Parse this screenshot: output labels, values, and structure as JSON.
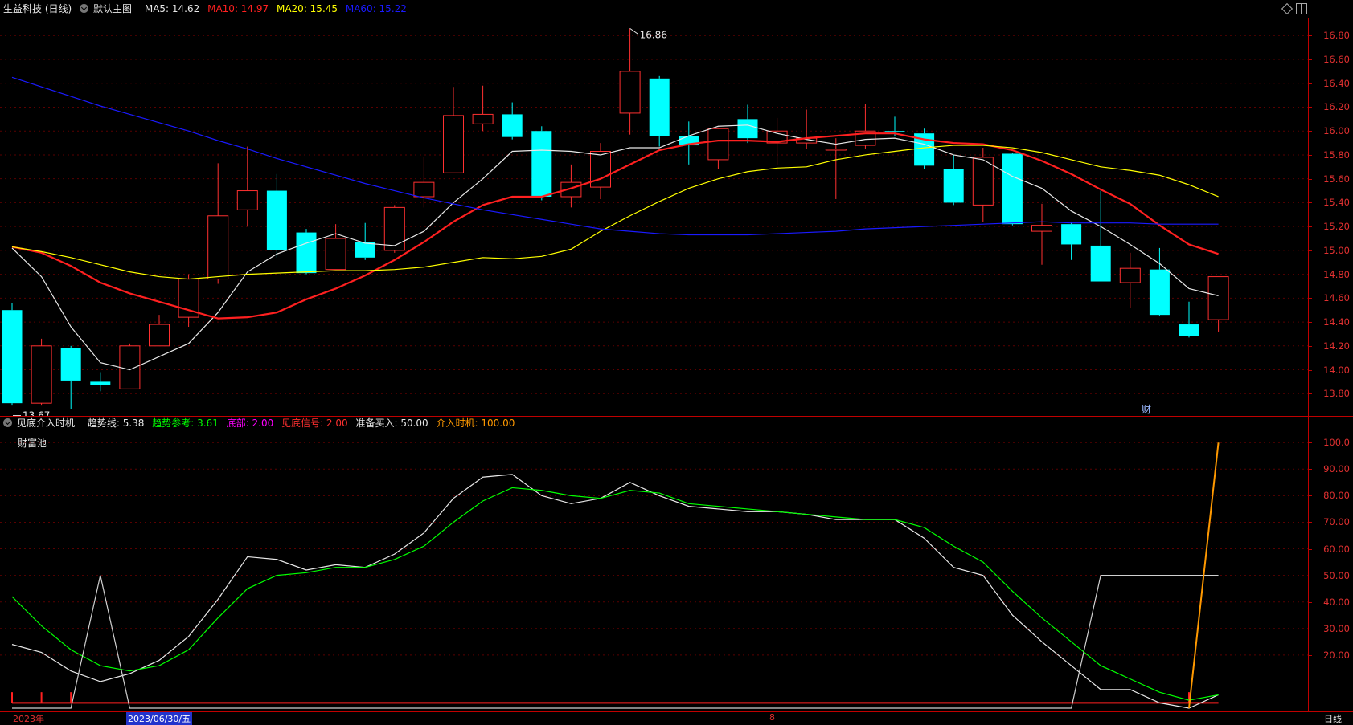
{
  "header": {
    "title": "生益科技 (日线)",
    "mode": "默认主图",
    "ma": [
      {
        "label": "MA5: 14.62",
        "color": "#e8e8e8"
      },
      {
        "label": "MA10: 14.97",
        "color": "#ff2020"
      },
      {
        "label": "MA20: 15.45",
        "color": "#ffff00"
      },
      {
        "label": "MA60: 15.22",
        "color": "#1a1aff"
      }
    ]
  },
  "indicator_header": {
    "name": "见底介入时机",
    "items": [
      {
        "label": "趋势线: 5.38",
        "color": "#e8e8e8"
      },
      {
        "label": "趋势参考: 3.61",
        "color": "#00ff00"
      },
      {
        "label": "底部: 2.00",
        "color": "#ff00ff"
      },
      {
        "label": "见底信号: 2.00",
        "color": "#ff3030"
      },
      {
        "label": "准备买入: 50.00",
        "color": "#e8e8e8"
      },
      {
        "label": "介入时机: 100.00",
        "color": "#ff9900"
      }
    ],
    "pool_label": "财富池"
  },
  "price_axis": [
    "16.80",
    "16.60",
    "16.40",
    "16.20",
    "16.00",
    "15.80",
    "15.60",
    "15.40",
    "15.20",
    "15.00",
    "14.80",
    "14.60",
    "14.40",
    "14.20",
    "14.00",
    "13.80"
  ],
  "ind_axis": [
    "100.0",
    "90.00",
    "80.00",
    "70.00",
    "60.00",
    "50.00",
    "40.00",
    "30.00",
    "20.00"
  ],
  "annotations": {
    "high": "16.86",
    "low": "13.67",
    "marker": "财"
  },
  "footer": {
    "year": "2023年",
    "date": "2023/06/30/五",
    "month": "8",
    "period": "日线"
  },
  "icons": [
    "diamond-icon",
    "panel-toggle-icon"
  ],
  "chart_data": [
    {
      "type": "candlestick",
      "title": "生益科技 (日线)",
      "ylim": [
        13.6,
        16.95
      ],
      "candles": [
        {
          "o": 14.5,
          "h": 14.56,
          "l": 13.7,
          "c": 13.72
        },
        {
          "o": 13.72,
          "h": 14.26,
          "l": 13.7,
          "c": 14.2
        },
        {
          "o": 14.18,
          "h": 14.2,
          "l": 13.67,
          "c": 13.91
        },
        {
          "o": 13.9,
          "h": 13.98,
          "l": 13.82,
          "c": 13.87
        },
        {
          "o": 13.84,
          "h": 14.22,
          "l": 13.84,
          "c": 14.2
        },
        {
          "o": 14.2,
          "h": 14.46,
          "l": 14.2,
          "c": 14.38
        },
        {
          "o": 14.44,
          "h": 14.8,
          "l": 14.36,
          "c": 14.76
        },
        {
          "o": 14.76,
          "h": 15.73,
          "l": 14.72,
          "c": 15.29
        },
        {
          "o": 15.34,
          "h": 15.87,
          "l": 15.2,
          "c": 15.5
        },
        {
          "o": 15.5,
          "h": 15.64,
          "l": 14.94,
          "c": 15.0
        },
        {
          "o": 15.15,
          "h": 15.18,
          "l": 14.8,
          "c": 14.81
        },
        {
          "o": 14.84,
          "h": 15.22,
          "l": 14.84,
          "c": 15.1
        },
        {
          "o": 15.07,
          "h": 15.23,
          "l": 14.92,
          "c": 14.94
        },
        {
          "o": 15.0,
          "h": 15.38,
          "l": 14.98,
          "c": 15.36
        },
        {
          "o": 15.45,
          "h": 15.78,
          "l": 15.36,
          "c": 15.57
        },
        {
          "o": 15.65,
          "h": 16.37,
          "l": 15.65,
          "c": 16.13
        },
        {
          "o": 16.06,
          "h": 16.38,
          "l": 16.0,
          "c": 16.14
        },
        {
          "o": 16.14,
          "h": 16.24,
          "l": 15.93,
          "c": 15.95
        },
        {
          "o": 16.0,
          "h": 16.04,
          "l": 15.42,
          "c": 15.45
        },
        {
          "o": 15.45,
          "h": 15.72,
          "l": 15.36,
          "c": 15.57
        },
        {
          "o": 15.53,
          "h": 15.9,
          "l": 15.43,
          "c": 15.83
        },
        {
          "o": 16.15,
          "h": 16.86,
          "l": 15.97,
          "c": 16.5
        },
        {
          "o": 16.44,
          "h": 16.46,
          "l": 15.87,
          "c": 15.96
        },
        {
          "o": 15.96,
          "h": 16.08,
          "l": 15.72,
          "c": 15.88
        },
        {
          "o": 15.76,
          "h": 16.03,
          "l": 15.68,
          "c": 16.02
        },
        {
          "o": 16.1,
          "h": 16.22,
          "l": 15.9,
          "c": 15.94
        },
        {
          "o": 15.9,
          "h": 16.11,
          "l": 15.72,
          "c": 16.0
        },
        {
          "o": 15.9,
          "h": 16.18,
          "l": 15.85,
          "c": 15.94
        },
        {
          "o": 15.85,
          "h": 15.94,
          "l": 15.43,
          "c": 15.85
        },
        {
          "o": 15.88,
          "h": 16.23,
          "l": 15.85,
          "c": 16.0
        },
        {
          "o": 16.0,
          "h": 16.12,
          "l": 15.96,
          "c": 15.99
        },
        {
          "o": 15.98,
          "h": 16.02,
          "l": 15.68,
          "c": 15.71
        },
        {
          "o": 15.68,
          "h": 15.8,
          "l": 15.38,
          "c": 15.4
        },
        {
          "o": 15.38,
          "h": 15.86,
          "l": 15.24,
          "c": 15.78
        },
        {
          "o": 15.81,
          "h": 15.82,
          "l": 15.21,
          "c": 15.22
        },
        {
          "o": 15.16,
          "h": 15.39,
          "l": 14.88,
          "c": 15.21
        },
        {
          "o": 15.22,
          "h": 15.24,
          "l": 14.92,
          "c": 15.05
        },
        {
          "o": 15.04,
          "h": 15.5,
          "l": 14.74,
          "c": 14.74
        },
        {
          "o": 14.73,
          "h": 14.98,
          "l": 14.52,
          "c": 14.85
        },
        {
          "o": 14.84,
          "h": 15.02,
          "l": 14.45,
          "c": 14.46
        },
        {
          "o": 14.38,
          "h": 14.57,
          "l": 14.27,
          "c": 14.28
        },
        {
          "o": 14.42,
          "h": 14.78,
          "l": 14.32,
          "c": 14.78
        }
      ],
      "series": [
        {
          "name": "MA5",
          "color": "#e8e8e8",
          "values": [
            15.02,
            14.78,
            14.36,
            14.06,
            14.0,
            14.11,
            14.22,
            14.48,
            14.82,
            14.97,
            15.06,
            15.14,
            15.06,
            15.04,
            15.16,
            15.4,
            15.6,
            15.83,
            15.84,
            15.83,
            15.8,
            15.86,
            15.86,
            15.96,
            16.04,
            16.05,
            15.98,
            15.93,
            15.89,
            15.93,
            15.94,
            15.89,
            15.8,
            15.76,
            15.62,
            15.52,
            15.33,
            15.2,
            15.05,
            14.89,
            14.68,
            14.62
          ]
        },
        {
          "name": "MA10",
          "color": "#ff2020",
          "values": [
            15.03,
            14.98,
            14.87,
            14.73,
            14.64,
            14.57,
            14.5,
            14.43,
            14.44,
            14.48,
            14.59,
            14.68,
            14.79,
            14.92,
            15.07,
            15.24,
            15.38,
            15.45,
            15.45,
            15.52,
            15.6,
            15.72,
            15.84,
            15.89,
            15.92,
            15.92,
            15.91,
            15.94,
            15.96,
            15.98,
            15.98,
            15.93,
            15.9,
            15.89,
            15.84,
            15.75,
            15.64,
            15.51,
            15.39,
            15.21,
            15.05,
            14.97
          ]
        },
        {
          "name": "MA20",
          "color": "#ffff00",
          "values": [
            15.03,
            14.99,
            14.94,
            14.88,
            14.82,
            14.78,
            14.76,
            14.78,
            14.8,
            14.81,
            14.82,
            14.83,
            14.83,
            14.84,
            14.86,
            14.9,
            14.94,
            14.93,
            14.95,
            15.01,
            15.16,
            15.29,
            15.41,
            15.52,
            15.6,
            15.66,
            15.69,
            15.7,
            15.76,
            15.8,
            15.83,
            15.86,
            15.88,
            15.88,
            15.86,
            15.82,
            15.76,
            15.7,
            15.67,
            15.63,
            15.55,
            15.45
          ]
        },
        {
          "name": "MA60",
          "color": "#1a1aff",
          "values": [
            16.45,
            16.37,
            16.29,
            16.21,
            16.14,
            16.07,
            16.0,
            15.92,
            15.85,
            15.77,
            15.7,
            15.63,
            15.56,
            15.5,
            15.44,
            15.39,
            15.34,
            15.3,
            15.26,
            15.22,
            15.18,
            15.16,
            15.14,
            15.13,
            15.13,
            15.13,
            15.14,
            15.15,
            15.16,
            15.18,
            15.19,
            15.2,
            15.21,
            15.22,
            15.23,
            15.24,
            15.23,
            15.23,
            15.23,
            15.22,
            15.22,
            15.22
          ]
        }
      ]
    },
    {
      "type": "line",
      "title": "见底介入时机",
      "ylim": [
        0,
        104
      ],
      "series": [
        {
          "name": "趋势线",
          "color": "#e8e8e8",
          "values": [
            24,
            21,
            14,
            10,
            13,
            18,
            27,
            41,
            57,
            56,
            52,
            54,
            53,
            58,
            66,
            79,
            87,
            88,
            80,
            77,
            79,
            85,
            80,
            76,
            75,
            74,
            74,
            73,
            71,
            71,
            71,
            64,
            53,
            50,
            35,
            25,
            16,
            7,
            7,
            2,
            0,
            5
          ]
        },
        {
          "name": "趋势参考",
          "color": "#00ff00",
          "values": [
            42,
            31,
            22,
            16,
            14,
            16,
            22,
            34,
            45,
            50,
            51,
            53,
            53,
            56,
            61,
            70,
            78,
            83,
            82,
            80,
            79,
            82,
            81,
            77,
            76,
            75,
            74,
            73,
            72,
            71,
            71,
            68,
            61,
            55,
            44,
            34,
            25,
            16,
            11,
            6,
            3,
            5
          ]
        },
        {
          "name": "准备买入",
          "color": "#d0d0d0",
          "values": [
            0,
            0,
            0,
            50,
            0,
            0,
            0,
            0,
            0,
            0,
            0,
            0,
            0,
            0,
            0,
            0,
            0,
            0,
            0,
            0,
            0,
            0,
            0,
            0,
            0,
            0,
            0,
            0,
            0,
            0,
            0,
            0,
            0,
            0,
            0,
            0,
            0,
            50,
            50,
            50,
            50,
            50
          ]
        },
        {
          "name": "介入时机",
          "color": "#ff9900",
          "values": [
            null,
            null,
            null,
            null,
            null,
            null,
            null,
            null,
            null,
            null,
            null,
            null,
            null,
            null,
            null,
            null,
            null,
            null,
            null,
            null,
            null,
            null,
            null,
            null,
            null,
            null,
            null,
            null,
            null,
            null,
            null,
            null,
            null,
            null,
            null,
            null,
            null,
            null,
            null,
            null,
            0,
            100
          ]
        }
      ]
    }
  ]
}
